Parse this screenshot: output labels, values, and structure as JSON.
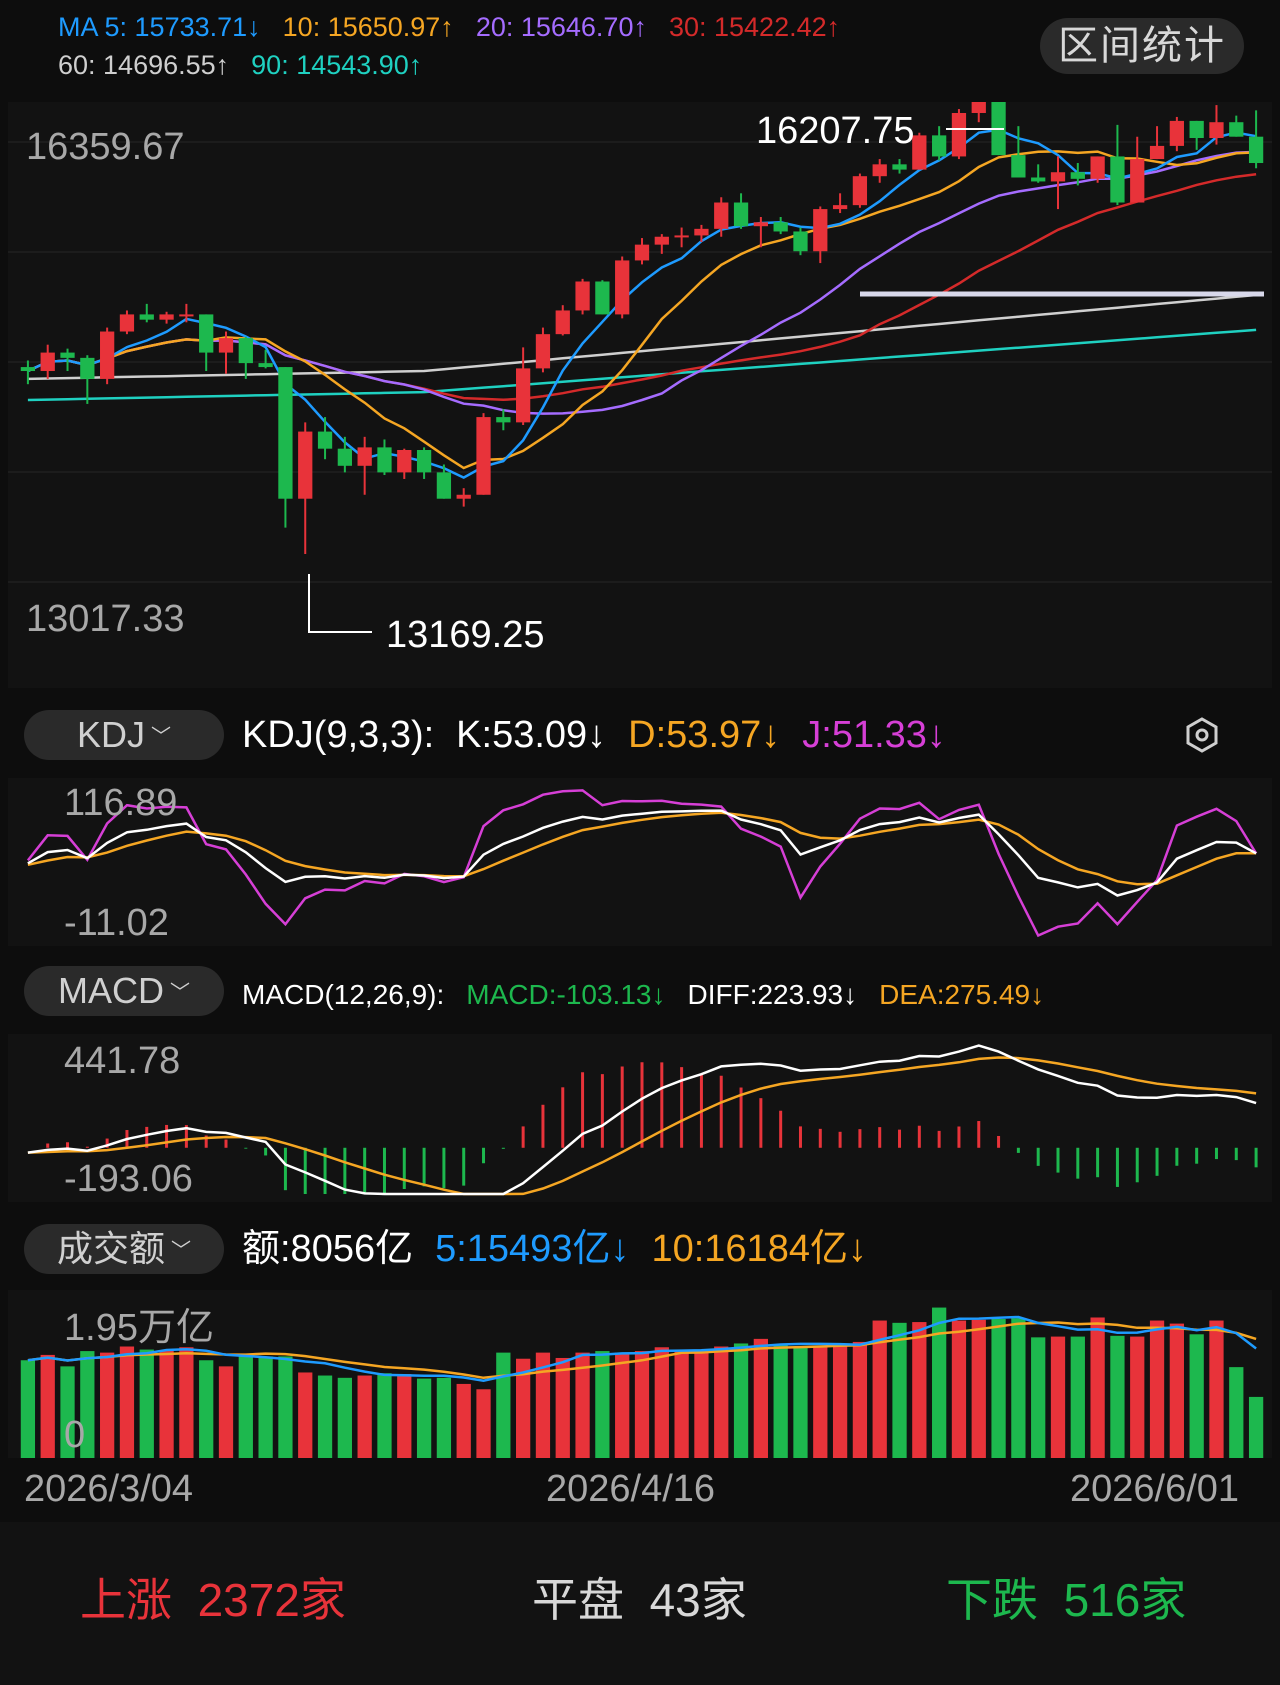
{
  "ma": {
    "row1": [
      {
        "label": "MA 5: 15733.71↓",
        "color": "#1e9bff"
      },
      {
        "label": "10: 15650.97↑",
        "color": "#f5a623"
      },
      {
        "label": "20: 15646.70↑",
        "color": "#a56cff"
      },
      {
        "label": "30: 15422.42↑",
        "color": "#d42a2a"
      }
    ],
    "row2": [
      {
        "label": "60: 14696.55↑",
        "color": "#cfcfcf"
      },
      {
        "label": "90: 14543.90↑",
        "color": "#1fd1c1"
      }
    ]
  },
  "range_button": "区间统计",
  "price_axis": {
    "top": "16359.67",
    "bottom": "13017.33"
  },
  "annotations": {
    "high": "16207.75",
    "low": "13169.25"
  },
  "kdj": {
    "button": "KDJ",
    "title": "KDJ(9,3,3):",
    "k": "K:53.09↓",
    "d": "D:53.97↓",
    "j": "J:51.33↓",
    "axis_top": "116.89",
    "axis_bottom": "-11.02",
    "settings_icon": "gear-icon"
  },
  "macd": {
    "button": "MACD",
    "title": "MACD(12,26,9):",
    "macd": "MACD:-103.13↓",
    "diff": "DIFF:223.93↓",
    "dea": "DEA:275.49↓",
    "axis_top": "441.78",
    "axis_bottom": "-193.06"
  },
  "volume": {
    "button": "成交额",
    "amount": "额:8056亿",
    "ma5": "5:15493亿↓",
    "ma10": "10:16184亿↓",
    "axis_top": "1.95万亿",
    "axis_bottom": "0"
  },
  "dates": [
    "2026/3/04",
    "2026/4/16",
    "2026/6/01"
  ],
  "market_stats": {
    "up_label": "上涨",
    "up_value": "2372家",
    "flat_label": "平盘",
    "flat_value": "43家",
    "down_label": "下跌",
    "down_value": "516家"
  },
  "colors": {
    "up": "#e8333a",
    "down": "#1db84e",
    "k": "#ffffff",
    "d": "#f5a623",
    "j": "#d63fd6"
  },
  "chart_data": {
    "type": "candlestick",
    "y_range": [
      13017.33,
      16359.67
    ],
    "candles": [
      [
        14650,
        14700,
        14520,
        14620
      ],
      [
        14620,
        14820,
        14560,
        14760
      ],
      [
        14760,
        14790,
        14620,
        14720
      ],
      [
        14720,
        14740,
        14370,
        14560
      ],
      [
        14560,
        14950,
        14520,
        14920
      ],
      [
        14920,
        15080,
        14900,
        15050
      ],
      [
        15050,
        15130,
        14990,
        15010
      ],
      [
        15010,
        15070,
        14980,
        15050
      ],
      [
        15050,
        15130,
        14990,
        15050
      ],
      [
        15050,
        15030,
        14620,
        14760
      ],
      [
        14760,
        14920,
        14600,
        14870
      ],
      [
        14870,
        14880,
        14560,
        14680
      ],
      [
        14680,
        14780,
        14640,
        14650
      ],
      [
        14650,
        14430,
        13430,
        13650
      ],
      [
        13650,
        14230,
        13230,
        14160
      ],
      [
        14160,
        14270,
        13950,
        14030
      ],
      [
        14030,
        14120,
        13850,
        13900
      ],
      [
        13900,
        14120,
        13680,
        14040
      ],
      [
        14040,
        14100,
        13830,
        13850
      ],
      [
        13850,
        14030,
        13800,
        14020
      ],
      [
        14020,
        14040,
        13800,
        13850
      ],
      [
        13850,
        13910,
        13650,
        13650
      ],
      [
        13650,
        13730,
        13590,
        13680
      ],
      [
        13680,
        14300,
        14000,
        14270
      ],
      [
        14270,
        14330,
        14170,
        14230
      ],
      [
        14230,
        14800,
        14210,
        14640
      ],
      [
        14640,
        14950,
        14610,
        14900
      ],
      [
        14900,
        15120,
        14890,
        15080
      ],
      [
        15080,
        15320,
        15050,
        15300
      ],
      [
        15300,
        15310,
        15090,
        15050
      ],
      [
        15050,
        15490,
        15020,
        15460
      ],
      [
        15460,
        15630,
        15430,
        15580
      ],
      [
        15580,
        15660,
        15510,
        15640
      ],
      [
        15640,
        15710,
        15560,
        15650
      ],
      [
        15650,
        15730,
        15600,
        15700
      ],
      [
        15700,
        15940,
        15640,
        15900
      ],
      [
        15900,
        15970,
        15700,
        15720
      ],
      [
        15720,
        15790,
        15560,
        15750
      ],
      [
        15750,
        15790,
        15660,
        15680
      ],
      [
        15680,
        15710,
        15500,
        15530
      ],
      [
        15530,
        15870,
        15440,
        15850
      ],
      [
        15850,
        15970,
        15820,
        15880
      ],
      [
        15880,
        16120,
        15860,
        16100
      ],
      [
        16100,
        16230,
        16050,
        16190
      ],
      [
        16190,
        16230,
        16120,
        16150
      ],
      [
        16150,
        16430,
        16160,
        16410
      ],
      [
        16410,
        16480,
        16220,
        16250
      ],
      [
        16250,
        16610,
        16230,
        16580
      ],
      [
        16580,
        16780,
        16510,
        16760
      ],
      [
        16760,
        16840,
        16270,
        16260
      ],
      [
        16260,
        16480,
        16100,
        16090
      ],
      [
        16090,
        16190,
        16050,
        16060
      ],
      [
        16060,
        16250,
        15850,
        16130
      ],
      [
        16130,
        16200,
        16030,
        16080
      ],
      [
        16080,
        16150,
        16050,
        16250
      ],
      [
        16250,
        16490,
        15880,
        15900
      ],
      [
        15900,
        16400,
        16250,
        16230
      ],
      [
        16230,
        16480,
        16260,
        16330
      ],
      [
        16330,
        16550,
        16290,
        16520
      ],
      [
        16520,
        16500,
        16300,
        16390
      ],
      [
        16390,
        16640,
        16340,
        16510
      ],
      [
        16510,
        16560,
        16480,
        16400
      ],
      [
        16400,
        16600,
        16160,
        16200
      ]
    ],
    "volume": [
      1.28,
      1.35,
      1.2,
      1.4,
      1.38,
      1.46,
      1.42,
      1.41,
      1.45,
      1.28,
      1.2,
      1.34,
      1.33,
      1.33,
      1.12,
      1.08,
      1.05,
      1.08,
      1.11,
      1.1,
      1.04,
      1.05,
      0.97,
      0.9,
      1.38,
      1.3,
      1.38,
      1.31,
      1.38,
      1.4,
      1.38,
      1.4,
      1.45,
      1.4,
      1.42,
      1.46,
      1.5,
      1.56,
      1.49,
      1.46,
      1.46,
      1.49,
      1.52,
      1.8,
      1.77,
      1.78,
      1.97,
      1.8,
      1.81,
      1.82,
      1.83,
      1.58,
      1.59,
      1.59,
      1.84,
      1.6,
      1.59,
      1.8,
      1.76,
      1.62,
      1.8,
      1.19,
      0.8
    ]
  }
}
